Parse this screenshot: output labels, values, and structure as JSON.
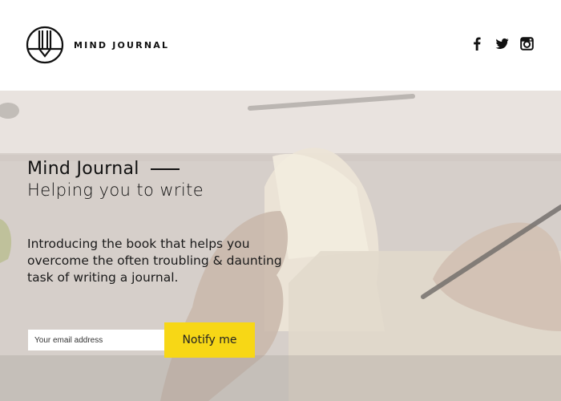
{
  "header": {
    "brand": "MIND JOURNAL",
    "logo_icon": "pencil-circle-icon",
    "social": [
      {
        "name": "facebook",
        "icon": "facebook-icon"
      },
      {
        "name": "twitter",
        "icon": "twitter-icon"
      },
      {
        "name": "instagram",
        "icon": "instagram-icon"
      }
    ]
  },
  "hero": {
    "title": "Mind Journal",
    "subtitle": "Helping you to write",
    "intro": "Introducing the book that helps you overcome the often troubling & daunting task of writing a journal.",
    "email_placeholder": "Your email address",
    "email_value": "",
    "notify_label": "Notify me"
  },
  "colors": {
    "accent": "#f7d716",
    "text": "#111111",
    "header_bg": "#ffffff"
  }
}
